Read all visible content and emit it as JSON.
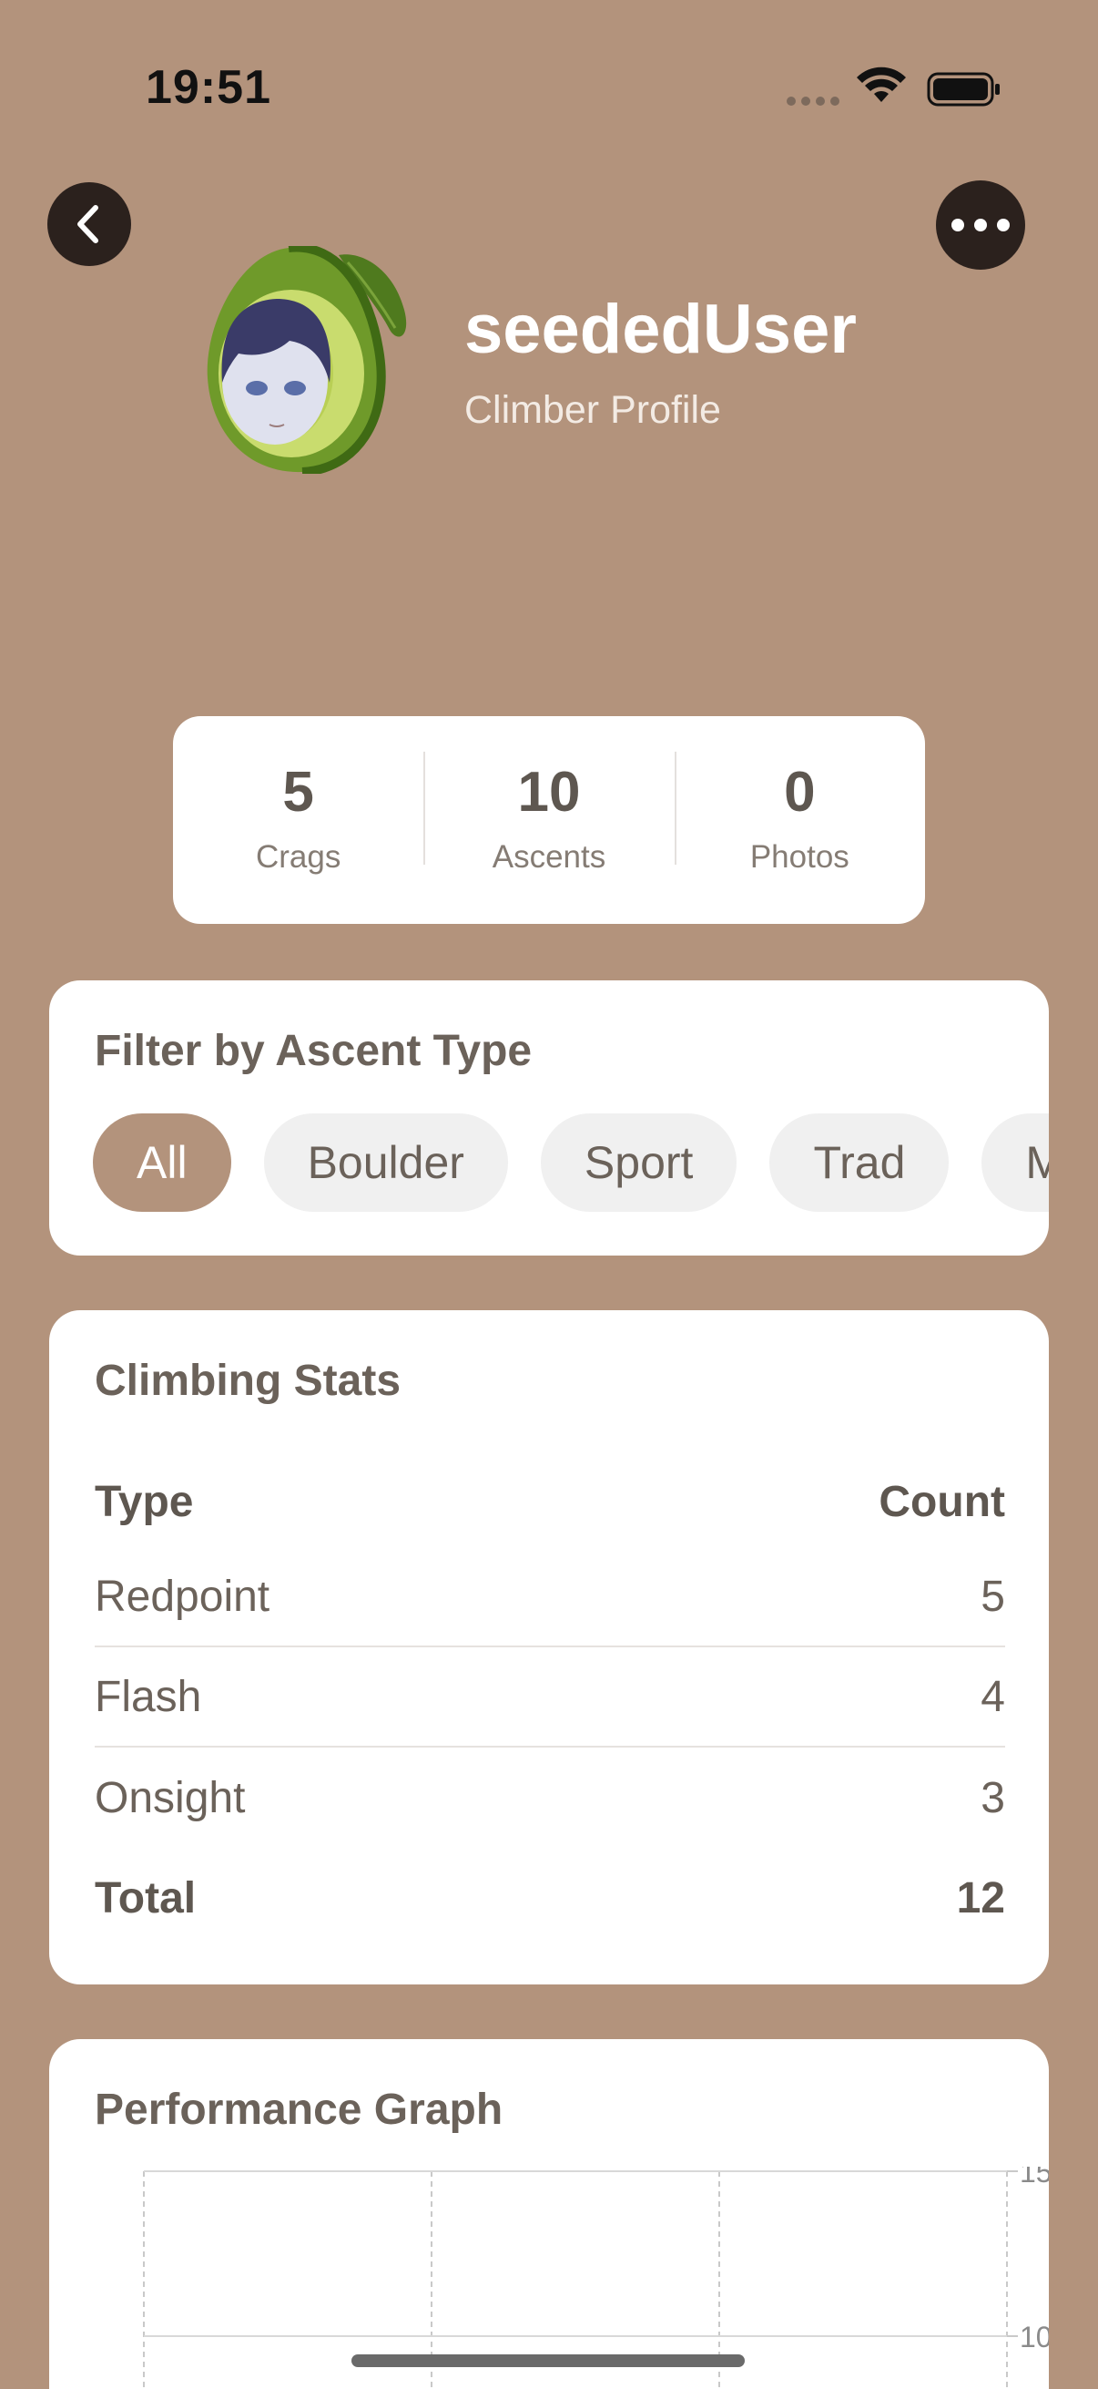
{
  "status_bar": {
    "time": "19:51"
  },
  "header": {
    "back_icon": "chevron-left-icon",
    "more_icon": "ellipsis-icon",
    "username": "seededUser",
    "subtitle": "Climber Profile"
  },
  "stats": [
    {
      "value": "5",
      "label": "Crags"
    },
    {
      "value": "10",
      "label": "Ascents"
    },
    {
      "value": "0",
      "label": "Photos"
    }
  ],
  "filter": {
    "title": "Filter by Ascent Type",
    "options": [
      "All",
      "Boulder",
      "Sport",
      "Trad",
      "M"
    ],
    "selected": "All"
  },
  "climbing_stats": {
    "title": "Climbing Stats",
    "headers": {
      "type": "Type",
      "count": "Count"
    },
    "rows": [
      {
        "type": "Redpoint",
        "count": "5"
      },
      {
        "type": "Flash",
        "count": "4"
      },
      {
        "type": "Onsight",
        "count": "3"
      }
    ],
    "total": {
      "type": "Total",
      "count": "12"
    }
  },
  "performance_graph": {
    "title": "Performance Graph",
    "y_ticks": [
      "15",
      "10"
    ]
  },
  "colors": {
    "background": "#b3937c",
    "accent": "#b3937c",
    "card": "#ffffff",
    "text": "#5e5750"
  }
}
